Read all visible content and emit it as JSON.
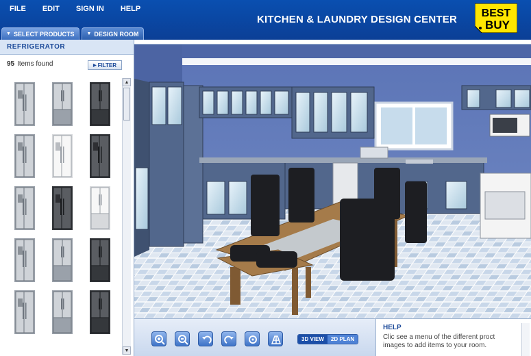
{
  "menu": [
    "FILE",
    "EDIT",
    "SIGN IN",
    "HELP"
  ],
  "app_title": "KITCHEN & LAUNDRY DESIGN CENTER",
  "logo": {
    "line1": "BEST",
    "line2": "BUY",
    "color": "#ffe600"
  },
  "tabs": [
    {
      "label": "SELECT PRODUCTS",
      "active": true
    },
    {
      "label": "DESIGN ROOM",
      "active": false
    }
  ],
  "catalog": {
    "category": "REFRIGERATOR",
    "count": "95",
    "count_suffix": "Items found",
    "filter_label": "FILTER",
    "products": [
      {
        "finish": "stainless",
        "style": "side-by-side"
      },
      {
        "finish": "stainless",
        "style": "french-door"
      },
      {
        "finish": "black",
        "style": "french-door"
      },
      {
        "finish": "stainless",
        "style": "side-by-side"
      },
      {
        "finish": "white",
        "style": "side-by-side"
      },
      {
        "finish": "black",
        "style": "side-by-side"
      },
      {
        "finish": "stainless",
        "style": "side-by-side"
      },
      {
        "finish": "black",
        "style": "side-by-side"
      },
      {
        "finish": "white",
        "style": "french-door"
      },
      {
        "finish": "stainless",
        "style": "side-by-side"
      },
      {
        "finish": "stainless",
        "style": "french-door"
      },
      {
        "finish": "black",
        "style": "french-door"
      },
      {
        "finish": "stainless",
        "style": "side-by-side"
      },
      {
        "finish": "stainless",
        "style": "french-door"
      },
      {
        "finish": "black",
        "style": "french-door"
      }
    ]
  },
  "toolbar": {
    "tools": [
      "zoom-in-icon",
      "zoom-out-icon",
      "rotate-left-icon",
      "rotate-right-icon",
      "reset-view-icon",
      "floor-grid-icon"
    ],
    "view_3d": "3D VIEW",
    "view_2d": "2D PLAN"
  },
  "help": {
    "title": "HELP",
    "text": "Clic see a menu of the different proct images to add items to your room."
  },
  "colors": {
    "header_blue": "#0b47a6",
    "wall_blue": "#5d76b5",
    "cabinet_blue": "#4f6387",
    "accent_yellow": "#ffe600"
  }
}
